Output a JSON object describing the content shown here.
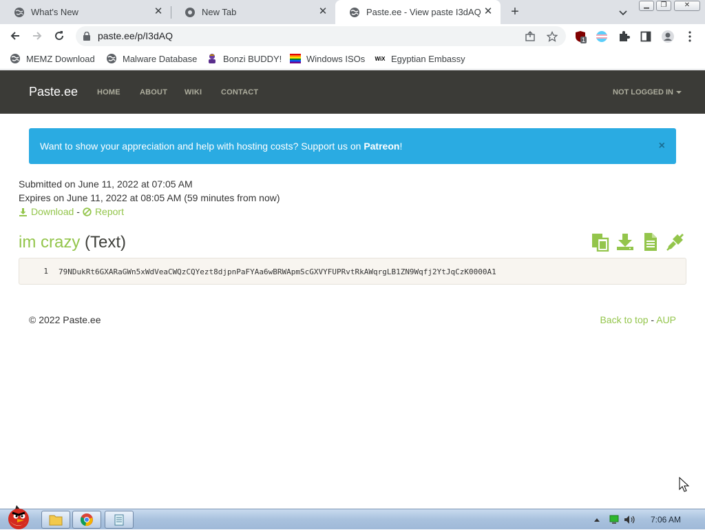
{
  "browser": {
    "tabs": [
      {
        "title": "What's New",
        "active": false
      },
      {
        "title": "New Tab",
        "active": false
      },
      {
        "title": "Paste.ee - View paste I3dAQ",
        "active": true
      }
    ],
    "url": "paste.ee/p/I3dAQ",
    "extension_badge": "1",
    "bookmarks": [
      {
        "label": "MEMZ Download",
        "icon": "globe-icon"
      },
      {
        "label": "Malware Database",
        "icon": "globe-icon"
      },
      {
        "label": "Bonzi BUDDY!",
        "icon": "bonzi-icon"
      },
      {
        "label": "Windows ISOs",
        "icon": "rainbow-flag-icon"
      },
      {
        "label": "Egyptian Embassy",
        "icon": "wix-icon"
      }
    ],
    "wix_text": "WiX"
  },
  "site": {
    "brand": "Paste.ee",
    "nav": [
      "HOME",
      "ABOUT",
      "WIKI",
      "CONTACT"
    ],
    "login": "NOT LOGGED IN",
    "alert": {
      "text": "Want to show your appreciation and help with hosting costs? Support us on ",
      "link": "Patreon",
      "suffix": "!",
      "close": "×"
    },
    "paste": {
      "submitted": "Submitted on June 11, 2022 at 07:05 AM",
      "expires": "Expires on June 11, 2022 at 08:05 AM (59 minutes from now)",
      "download": "Download",
      "separator": "-",
      "report": "Report",
      "name": "im crazy",
      "type": "(Text)",
      "line_number": "1",
      "code": "79NDukRt6GXARaGWn5xWdVeaCWQzCQYezt8djpnPaFYAa6wBRWApmScGXVYFUPRvtRkAWqrgLB1ZN9Wqfj2YtJqCzK0000A1"
    },
    "footer": {
      "copyright": "© 2022 Paste.ee",
      "back_to_top": "Back to top",
      "separator": "-",
      "aup": "AUP"
    }
  },
  "taskbar": {
    "clock": "7:06 AM"
  },
  "colors": {
    "accent_green": "#93c54b",
    "navbar": "#3b3b37",
    "alert": "#2aabe2"
  }
}
